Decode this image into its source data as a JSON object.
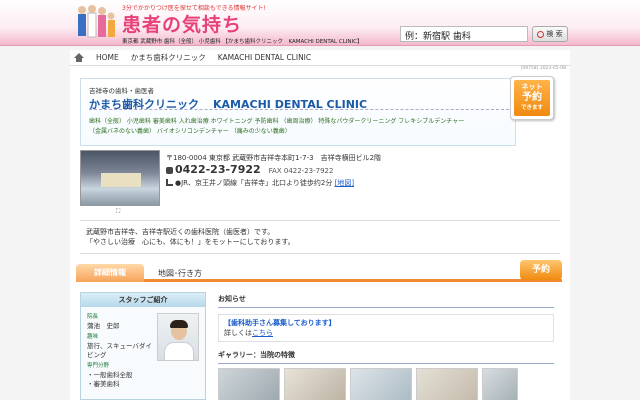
{
  "header": {
    "tagline": "3分でかかりつけ医を探せて相談もできる情報サイト!",
    "site_title": "患者の気持ち",
    "nav_path": "東京都 武蔵野市 歯科（全般） 小児歯科 【かまち歯科クリニック　KAMACHI DENTAL CLINIC】",
    "search_placeholder": "例：新宿駅 歯科",
    "search_label": "検 索"
  },
  "breadcrumb": {
    "home": "HOME",
    "items": [
      "かまち歯科クリニック",
      "KAMACHI DENTAL CLINIC"
    ]
  },
  "updated": "[09758] 2023-05-08",
  "clinic": {
    "kicker": "吉祥寺の歯科・歯医者",
    "name_ja": "かまち歯科クリニック",
    "name_en": "KAMACHI DENTAL CLINIC",
    "tags_line1": "歯科（全般）  小児歯科  審美歯科  入れ歯治療  ホワイトニング  予防歯科  （歯周治療）  特殊なパウダークリーニング  フレキシブルデンチャー",
    "tags_line2": "（金属バネのない義歯）  バイオシリコンデンチャー  （痛みの少ない義歯）",
    "postal_address": "〒180-0004 東京都 武蔵野市吉祥寺本町1-7-3　吉祥寺横田ビル2階",
    "phone": "0422-23-7922",
    "fax": "FAX 0422-23-7922",
    "access": "●JR、京王井ノ頭線「吉祥寺」北口より徒歩约2分",
    "map_link": "[地図]",
    "intro_line1": "武蔵野市吉祥寺、吉祥寺駅近くの歯科医院（歯医者）です。",
    "intro_line2": "「やさしい治療　心にも、体にも！」をモットーにしております。"
  },
  "reserve_badge": {
    "line1": "ネット",
    "line2": "予約",
    "line3": "できます"
  },
  "photo_zoom": "⛶",
  "tabs": {
    "detail": "詳細情報",
    "map": "地図･行き方",
    "reserve": "予約"
  },
  "staff": {
    "title": "スタッフご紹介",
    "role_label": "院長",
    "name": "蒲池　史郎",
    "hobby_label": "趣味",
    "hobby": "旅行、スキューバダイビング",
    "specialty_label": "専門分野",
    "specialty1": "・一般歯科全般",
    "specialty2": "・審美歯科"
  },
  "news": {
    "title": "お知らせ",
    "headline": "【歯科助手さん募集しております】",
    "detail_prefix": "詳しくは",
    "detail_link": "こちら"
  },
  "gallery": {
    "title": "ギャラリー：当院の特徴"
  }
}
